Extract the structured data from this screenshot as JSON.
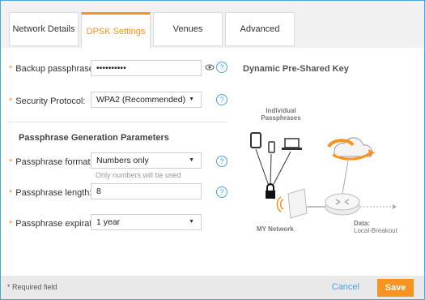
{
  "tabs": [
    {
      "label": "Network Details"
    },
    {
      "label": "DPSK Settings"
    },
    {
      "label": "Venues"
    },
    {
      "label": "Advanced"
    }
  ],
  "form": {
    "backup_passphrase": {
      "label": "Backup passphrase:",
      "value": "••••••••••"
    },
    "security_protocol": {
      "label": "Security Protocol:",
      "value": "WPA2 (Recommended)"
    },
    "section_title": "Passphrase Generation Parameters",
    "passphrase_format": {
      "label": "Passphrase format:",
      "value": "Numbers only",
      "hint": "Only numbers will be used"
    },
    "passphrase_length": {
      "label": "Passphrase length:",
      "value": "8"
    },
    "passphrase_expiration": {
      "label": "Passphrase expiration:",
      "value": "1 year"
    }
  },
  "diagram": {
    "title": "Dynamic Pre-Shared Key",
    "individual": "Individual",
    "passphrases": "Passphrases",
    "my_network": "MY Network",
    "data": "Data:",
    "local_breakout": "Local-Breakout"
  },
  "footer": {
    "required": "* Required field",
    "cancel": "Cancel",
    "save": "Save"
  },
  "icons": {
    "required_mark": "*",
    "eye": "eye-icon",
    "help": "?",
    "dropdown": "▼"
  },
  "colors": {
    "accent": "#f7931e",
    "link": "#4aa3df"
  }
}
